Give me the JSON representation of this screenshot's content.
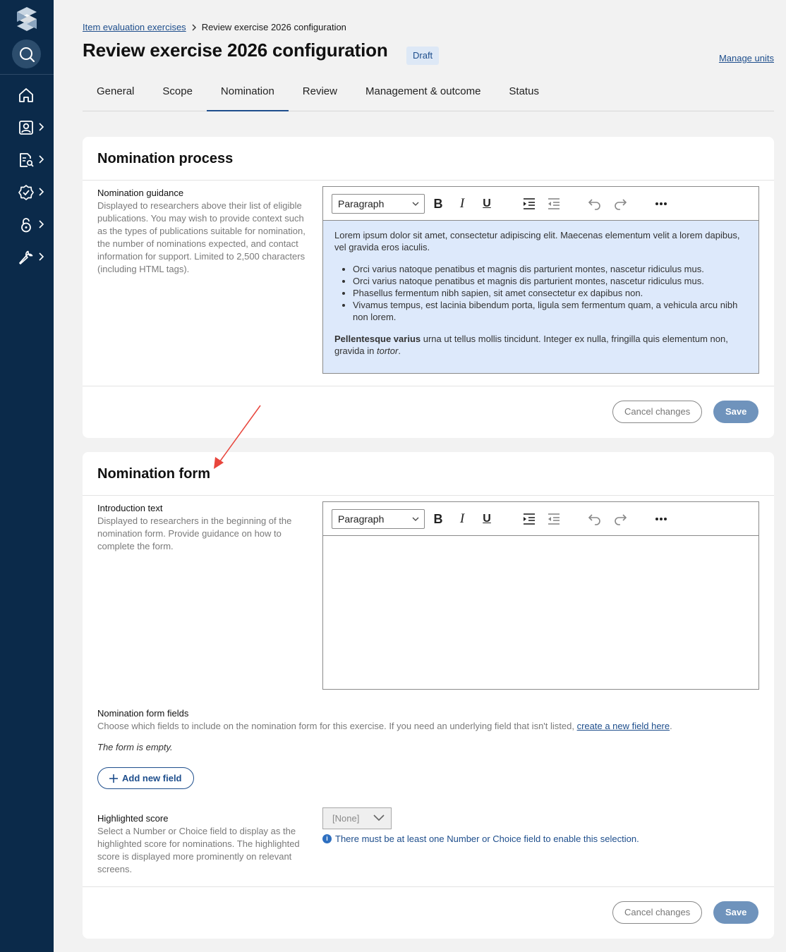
{
  "sidebar": {
    "items": [
      {
        "icon": "home-icon",
        "has_chevron": false
      },
      {
        "icon": "person-portrait-icon",
        "has_chevron": true
      },
      {
        "icon": "document-search-icon",
        "has_chevron": true
      },
      {
        "icon": "badge-check-icon",
        "has_chevron": true
      },
      {
        "icon": "lock-icon",
        "has_chevron": true
      },
      {
        "icon": "wrench-icon",
        "has_chevron": true
      }
    ]
  },
  "breadcrumb": {
    "parent": "Item evaluation exercises",
    "current": "Review exercise 2026 configuration"
  },
  "page": {
    "title": "Review exercise 2026 configuration",
    "status_badge": "Draft",
    "manage_units": "Manage units"
  },
  "tabs": [
    {
      "label": "General"
    },
    {
      "label": "Scope"
    },
    {
      "label": "Nomination"
    },
    {
      "label": "Review"
    },
    {
      "label": "Management & outcome"
    },
    {
      "label": "Status"
    }
  ],
  "active_tab": "Nomination",
  "editor_toolbar": {
    "format_select": "Paragraph",
    "tools": [
      "bold-icon",
      "italic-icon",
      "underline-icon",
      "indent-icon",
      "outdent-icon",
      "undo-icon",
      "redo-icon",
      "more-icon"
    ]
  },
  "process_card": {
    "title": "Nomination process",
    "field_label": "Nomination guidance",
    "field_help": "Displayed to researchers above their list of eligible publications. You may wish to provide context such as the types of publications suitable for nomination, the number of nominations expected, and contact information for support. Limited to 2,500 characters (including HTML tags).",
    "content": {
      "intro": "Lorem ipsum dolor sit amet, consectetur adipiscing elit. Maecenas elementum velit a lorem dapibus, vel gravida eros iaculis.",
      "bullets": [
        "Orci varius natoque penatibus et magnis dis parturient montes, nascetur ridiculus mus.",
        "Orci varius natoque penatibus et magnis dis parturient montes, nascetur ridiculus mus.",
        "Phasellus fermentum nibh sapien, sit amet consectetur ex dapibus non.",
        "Vivamus tempus, est lacinia bibendum porta, ligula sem fermentum quam, a vehicula arcu nibh non lorem."
      ],
      "outro_bold": "Pellentesque varius",
      "outro_mid": " urna ut tellus mollis tincidunt. Integer ex nulla, fringilla quis elementum non, gravida in ",
      "outro_italic": "tortor",
      "outro_end": "."
    },
    "cancel_label": "Cancel changes",
    "save_label": "Save"
  },
  "form_card": {
    "title": "Nomination form",
    "intro_label": "Introduction text",
    "intro_help": "Displayed to researchers in the beginning of the nomination form. Provide guidance on how to complete the form.",
    "fields_label": "Nomination form fields",
    "fields_help": "Choose which fields to include on the nomination form for this exercise. If you need an underlying field that isn't listed, ",
    "fields_link": "create a new field here",
    "fields_help_end": ".",
    "empty_text": "The form is empty.",
    "add_field_label": "Add new field",
    "score_label": "Highlighted score",
    "score_help": "Select a Number or Choice field to display as the highlighted score for nominations. The highlighted score is displayed more prominently on relevant screens.",
    "score_value": "[None]",
    "score_info": "There must be at least one Number or Choice field to enable this selection.",
    "cancel_label": "Cancel changes",
    "save_label": "Save"
  },
  "colors": {
    "sidebar": "#0b2a4a",
    "accent": "#1e4e8c",
    "save_button": "#6f93bc",
    "editor_highlight": "#dde9fb",
    "annotation_arrow": "#e8453c"
  }
}
